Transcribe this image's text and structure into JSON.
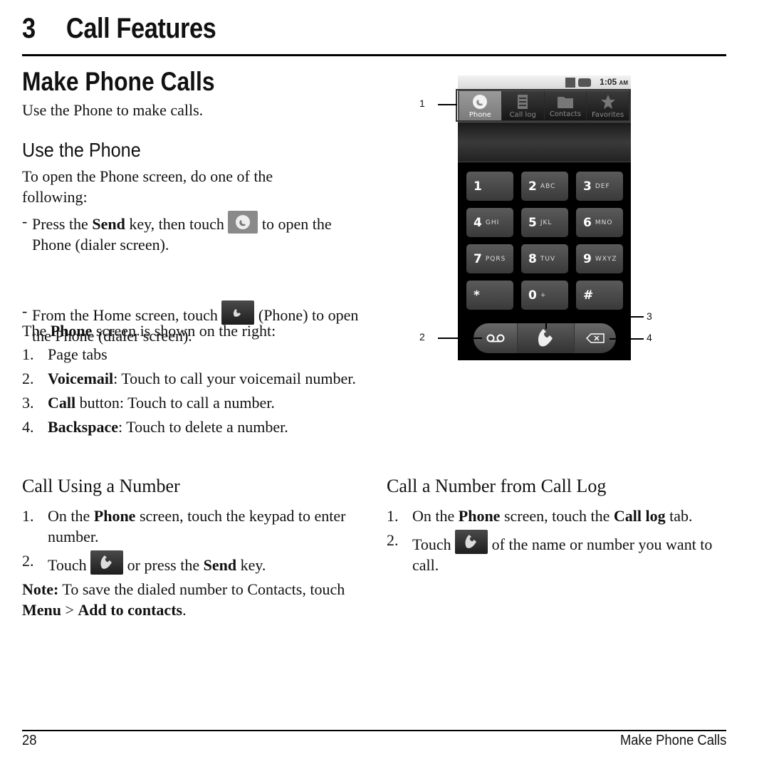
{
  "chapter": {
    "number": "3",
    "title": "Call Features"
  },
  "section": {
    "title": "Make Phone Calls",
    "intro": "Use the Phone to make calls."
  },
  "use_phone": {
    "heading": "Use the Phone",
    "lead": "To open the Phone screen, do one of the following:",
    "items": [
      {
        "bullet": "-",
        "pre": "Press the ",
        "bold": "Send",
        "mid": " key, then touch ",
        "icon": "phone-tab-icon",
        "post": " to open the Phone (dialer screen)."
      },
      {
        "bullet": "-",
        "pre": "From the Home screen, touch ",
        "icon": "phone-app-icon",
        "post": " (Phone) to open the Phone (dialer screen)."
      }
    ],
    "screen_lead_pre": "The ",
    "screen_lead_bold": "Phone",
    "screen_lead_post": " screen is shown on the right:",
    "legend": [
      {
        "n": "1.",
        "bold": "",
        "text": "Page tabs"
      },
      {
        "n": "2.",
        "bold": "Voicemail",
        "text": ": Touch to call your voicemail number."
      },
      {
        "n": "3.",
        "bold": "Call",
        "text": " button: Touch to call a number."
      },
      {
        "n": "4.",
        "bold": "Backspace",
        "text": ": Touch to delete a number."
      }
    ]
  },
  "call_using_number": {
    "heading": "Call Using a Number",
    "steps": [
      {
        "n": "1.",
        "pre": "On the ",
        "bold": "Phone",
        "post": " screen, touch the keypad to enter number."
      },
      {
        "n": "2.",
        "pre": "Touch ",
        "icon": "call-button-icon",
        "mid": " or press the ",
        "bold": "Send",
        "post": " key."
      }
    ],
    "note_label": "Note:",
    "note_text": " To save the dialed number to Contacts, touch ",
    "note_menu": "Menu",
    "note_sep": " > ",
    "note_action": "Add to contacts",
    "note_end": "."
  },
  "call_from_log": {
    "heading": "Call a Number from Call Log",
    "steps": [
      {
        "n": "1.",
        "pre": "On the ",
        "bold": "Phone",
        "mid": " screen, touch the ",
        "bold2": "Call log",
        "post": " tab."
      },
      {
        "n": "2.",
        "pre": "Touch ",
        "icon": "call-button-icon",
        "post": " of the name or number you want to call."
      }
    ]
  },
  "phone_screen": {
    "status_time": "1:05",
    "status_ampm": "AM",
    "tabs": [
      {
        "label": "Phone",
        "icon": "phone-icon",
        "active": true
      },
      {
        "label": "Call log",
        "icon": "list-icon",
        "active": false
      },
      {
        "label": "Contacts",
        "icon": "contacts-icon",
        "active": false
      },
      {
        "label": "Favorites",
        "icon": "star-icon",
        "active": false
      }
    ],
    "keys": [
      {
        "digit": "1",
        "letters": ""
      },
      {
        "digit": "2",
        "letters": "ABC"
      },
      {
        "digit": "3",
        "letters": "DEF"
      },
      {
        "digit": "4",
        "letters": "GHI"
      },
      {
        "digit": "5",
        "letters": "JKL"
      },
      {
        "digit": "6",
        "letters": "MNO"
      },
      {
        "digit": "7",
        "letters": "PQRS"
      },
      {
        "digit": "8",
        "letters": "TUV"
      },
      {
        "digit": "9",
        "letters": "WXYZ"
      },
      {
        "digit": "*",
        "letters": ""
      },
      {
        "digit": "0",
        "letters": "+"
      },
      {
        "digit": "#",
        "letters": ""
      }
    ],
    "callouts": [
      "1",
      "2",
      "3",
      "4"
    ]
  },
  "footer": {
    "page": "28",
    "section": "Make Phone Calls"
  }
}
